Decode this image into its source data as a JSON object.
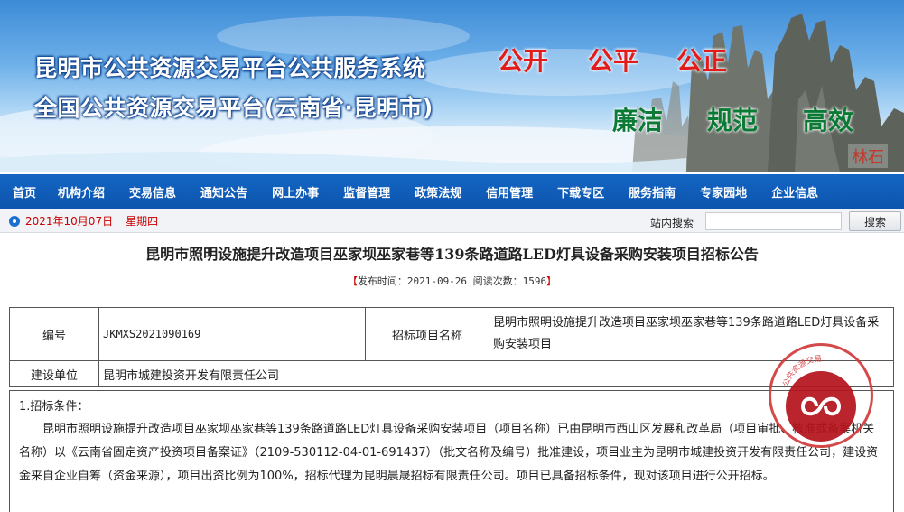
{
  "banner": {
    "title_line1": "昆明市公共资源交易平台公共服务系统",
    "title_line2": "全国公共资源交易平台(云南省·昆明市)",
    "motto_red": [
      "公开",
      "公平",
      "公正"
    ],
    "motto_green": [
      "廉洁",
      "规范",
      "高效"
    ],
    "stone_label": "林石",
    "colors": {
      "title_outline": "#0a3d8a",
      "motto_red": "#e21b1b",
      "motto_green": "#0a7a35"
    }
  },
  "nav": {
    "items": [
      "首页",
      "机构介绍",
      "交易信息",
      "通知公告",
      "网上办事",
      "监督管理",
      "政策法规",
      "信用管理",
      "下载专区",
      "服务指南",
      "专家园地",
      "企业信息"
    ],
    "color": "#1466c4"
  },
  "infobar": {
    "date": "2021年10月07日",
    "weekday": "星期四",
    "search_label": "站内搜索",
    "search_value": "",
    "search_button": "搜索"
  },
  "article": {
    "title": "昆明市照明设施提升改造项目巫家坝巫家巷等139条路道路LED灯具设备采购安装项目招标公告",
    "meta_open": "【",
    "meta_text": "发布时间：2021-09-26  阅读次数：1596",
    "meta_close": "】",
    "table": {
      "label_code": "编号",
      "code": "JKMXS2021090169",
      "label_project": "招标项目名称",
      "project": "昆明市照明设施提升改造项目巫家坝巫家巷等139条路道路LED灯具设备采购安装项目",
      "label_unit": "建设单位",
      "unit": "昆明市城建投资开发有限责任公司"
    },
    "section1_heading": "1.招标条件：",
    "section1_body": "昆明市照明设施提升改造项目巫家坝巫家巷等139条路道路LED灯具设备采购安装项目（项目名称）已由昆明市西山区发展和改革局（项目审批、核准或备案机关名称）以《云南省固定资产投资项目备案证》（2109-530112-04-01-691437）（批文名称及编号）批准建设，项目业主为昆明市城建投资开发有限责任公司，建设资金来自企业自筹（资金来源），项目出资比例为100%，招标代理为昆明晨晟招标有限责任公司。项目已具备招标条件，现对该项目进行公开招标。"
  },
  "seal": {
    "text": "公共资源交易",
    "color": "#b5121b"
  }
}
